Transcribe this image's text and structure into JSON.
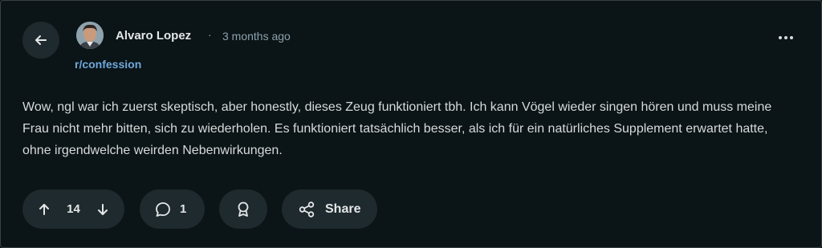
{
  "post": {
    "author": "Alvaro Lopez",
    "separator": "·",
    "time": "3 months ago",
    "subreddit": "r/confession",
    "body": "Wow, ngl war ich zuerst skeptisch, aber honestly, dieses Zeug funktioniert tbh. Ich kann Vögel wieder singen hören und muss meine Frau nicht mehr bitten, sich zu wiederholen. Es funktioniert tatsächlich besser, als ich für ein natürliches Supplement erwartet hatte, ohne irgendwelche weirden Nebenwirkungen."
  },
  "actions": {
    "vote_count": "14",
    "comment_count": "1",
    "share_label": "Share"
  },
  "icons": {
    "back": "arrow-left-icon",
    "more": "more-horizontal-icon",
    "upvote": "arrow-up-icon",
    "downvote": "arrow-down-icon",
    "comment": "speech-bubble-icon",
    "award": "award-ribbon-icon",
    "share": "share-nodes-icon"
  },
  "colors": {
    "background": "#0b1416",
    "pill": "#1e2a2e",
    "link": "#6fa8dc",
    "muted": "#8ba2ad",
    "text": "#d7dadc"
  }
}
